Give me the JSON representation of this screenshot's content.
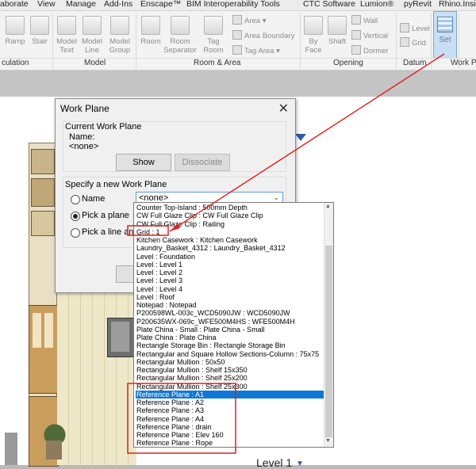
{
  "ribbon": {
    "tabs": [
      "aborate",
      "View",
      "Manage",
      "Add-Ins",
      "Enscape™",
      "BIM Interoperability Tools",
      "CTC Software",
      "Lumion®",
      "pyRevit",
      "Rhino.Inside"
    ],
    "tools": {
      "ramp": "Ramp",
      "stair": "Stair",
      "model_text": [
        "Model",
        "Text"
      ],
      "model_line": [
        "Model",
        "Line"
      ],
      "model_group": [
        "Model",
        "Group"
      ],
      "room": "Room",
      "room_separator": [
        "Room",
        "Separator"
      ],
      "tag_room": [
        "Tag",
        "Room"
      ],
      "area": "Area",
      "area_boundary": "Area  Boundary",
      "tag_area": "Tag  Area",
      "by_face": [
        "By",
        "Face"
      ],
      "shaft": "Shaft",
      "wall": "Wall",
      "vertical": "Vertical",
      "dormer": "Dormer",
      "level": "Level",
      "grid": "Grid",
      "set": "Set"
    },
    "panels": {
      "circulation": "culation",
      "model": "Model",
      "room_area": "Room & Area",
      "opening": "Opening",
      "datum": "Datum",
      "work_plane": "Work P"
    }
  },
  "dialog": {
    "title": "Work Plane",
    "close_glyph": "✕",
    "current_group": "Current Work Plane",
    "name_label": "Name:",
    "name_value": "<none>",
    "show_label": "Show",
    "dissociate_label": "Dissociate",
    "specify_group": "Specify a new Work Plane",
    "radio_name": "Name",
    "radio_pick_plane": "Pick a plane",
    "radio_pick_line": "Pick a line and use",
    "selected_radio": "pick_plane",
    "combo_value": "<none>"
  },
  "dropdown": {
    "items": [
      "Counter Top-Island : 500mm Depth",
      "CW Full Glaze Clip : CW Full Glaze Clip",
      "CW Full Glaze Clip : Railing",
      "Grid : 1",
      "Kitchen Casework : Kitchen Casework",
      "Laundry_Basket_4312 : Laundry_Basket_4312",
      "Level : Foundation",
      "Level : Level 1",
      "Level : Level 2",
      "Level : Level 3",
      "Level : Level 4",
      "Level : Roof",
      "Notepad : Notepad",
      "P200598WL-003c_WCD5090JW : WCD5090JW",
      "P200635WX-069c_WFE500M4HS : WFE500M4H",
      "Plate China - Small : Plate China - Small",
      "Plate China : Plate China",
      "Rectangle Storage Bin : Rectangle Storage Bin",
      "Rectangular and Square Hollow Sections-Column : 75x75",
      "Rectangular Mullion : 50x50",
      "Rectangular Mullion : Shelf 15x350",
      "Rectangular Mullion : Shelf 25x200",
      "Rectangular Mullion : Shelf 25x300",
      "Reference Plane : A1",
      "Reference Plane : A2",
      "Reference Plane : A3",
      "Reference Plane : A4",
      "Reference Plane : drain",
      "Reference Plane : Elev 160",
      "Reference Plane : Rope"
    ],
    "selected_index": 23,
    "scroll_up": "▲",
    "scroll_down": "▼"
  },
  "view": {
    "level_label": "Level 1",
    "level_marker": "▼"
  },
  "colors": {
    "highlight_red": "#e02020",
    "selection_blue": "#0f78d7",
    "ribbon_bg": "#f3f3f3"
  }
}
